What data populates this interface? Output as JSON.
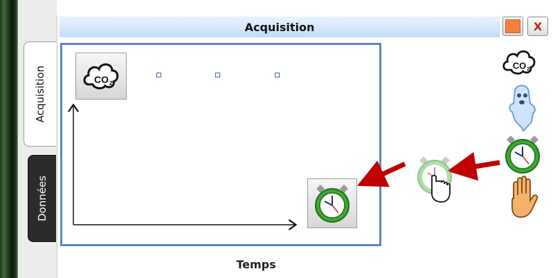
{
  "window": {
    "title": "Acquisition"
  },
  "tabs": [
    {
      "label": "Acquisition",
      "active": true
    },
    {
      "label": "Données",
      "active": false
    }
  ],
  "graph": {
    "x_axis_label": "Temps"
  },
  "toolbar": {
    "items": [
      "co2-sensor",
      "ghost",
      "stopwatch",
      "hand"
    ]
  },
  "colors": {
    "title_bar": "#c2ddf6",
    "plot_border": "#5b83c6",
    "arrows": "#c00000",
    "color_button": "#f57f3a",
    "close": "#c0221b"
  }
}
